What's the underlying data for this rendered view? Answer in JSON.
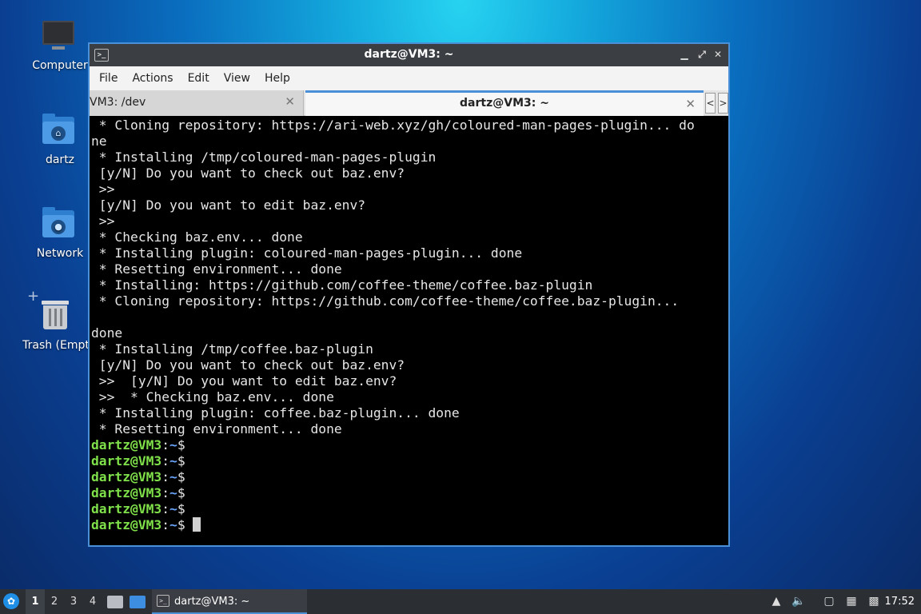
{
  "desktop": {
    "icons": [
      {
        "label": "Computer"
      },
      {
        "label": "dartz"
      },
      {
        "label": "Network"
      },
      {
        "label": "Trash (Empt"
      }
    ]
  },
  "window": {
    "title": "dartz@VM3: ~",
    "controls": {
      "minimize": "▁",
      "maximize": "⤢",
      "close": "✕"
    },
    "menu": [
      "File",
      "Actions",
      "Edit",
      "View",
      "Help"
    ],
    "tabs": [
      {
        "label": "VM3: /dev",
        "active": false
      },
      {
        "label": "dartz@VM3: ~",
        "active": true
      }
    ],
    "tab_close": "✕",
    "tab_scroll_left": "<",
    "tab_scroll_right": ">"
  },
  "terminal": {
    "output_lines": [
      " * Cloning repository: https://ari-web.xyz/gh/coloured-man-pages-plugin... do",
      "ne",
      " * Installing /tmp/coloured-man-pages-plugin",
      " [y/N] Do you want to check out baz.env?",
      " >>",
      " [y/N] Do you want to edit baz.env?",
      " >>",
      " * Checking baz.env... done",
      " * Installing plugin: coloured-man-pages-plugin... done",
      " * Resetting environment... done",
      " * Installing: https://github.com/coffee-theme/coffee.baz-plugin",
      " * Cloning repository: https://github.com/coffee-theme/coffee.baz-plugin...",
      "",
      "done",
      " * Installing /tmp/coffee.baz-plugin",
      " [y/N] Do you want to check out baz.env?",
      " >>  [y/N] Do you want to edit baz.env?",
      " >>  * Checking baz.env... done",
      " * Installing plugin: coffee.baz-plugin... done",
      " * Resetting environment... done"
    ],
    "prompt": {
      "user_host": "dartz@VM3",
      "sep": ":",
      "path": "~",
      "symbol": "$"
    },
    "prompt_count": 6
  },
  "taskbar": {
    "workspaces": [
      "1",
      "2",
      "3",
      "4"
    ],
    "active_workspace": "1",
    "task_label": "dartz@VM3: ~",
    "clock": "17:52"
  }
}
